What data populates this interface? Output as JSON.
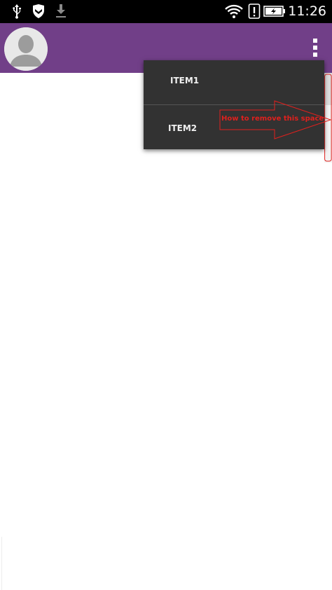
{
  "status_bar": {
    "time": "11:26",
    "icons": [
      "usb-icon",
      "shield-icon",
      "download-icon",
      "wifi-icon",
      "alert-icon",
      "battery-charging-icon"
    ]
  },
  "app_bar": {
    "color": "#713f88",
    "avatar_icon": "user-silhouette-icon",
    "overflow_icon": "more-vertical-icon"
  },
  "menu": {
    "background": "#323232",
    "items": [
      {
        "label": "ITEM1"
      },
      {
        "label": "ITEM2"
      }
    ]
  },
  "annotation": {
    "text": "How to remove this space",
    "color": "#e0201d"
  }
}
